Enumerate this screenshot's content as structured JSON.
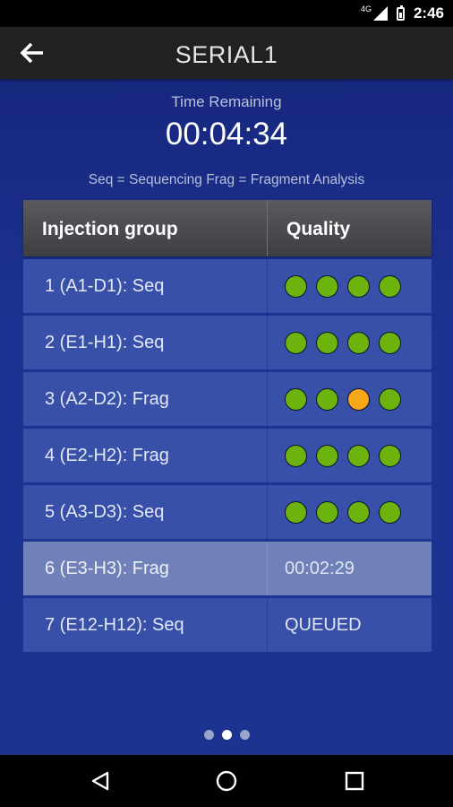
{
  "status_bar": {
    "network": "4G",
    "time": "2:46"
  },
  "app_bar": {
    "title": "SERIAL1",
    "back_icon": "arrow-left-icon"
  },
  "timer": {
    "label": "Time Remaining",
    "value": "00:04:34"
  },
  "legend": "Seq = Sequencing Frag = Fragment Analysis",
  "table": {
    "headers": {
      "group": "Injection group",
      "quality": "Quality"
    },
    "rows": [
      {
        "group": "1 (A1-D1): Seq",
        "quality_dots": [
          "green",
          "green",
          "green",
          "green"
        ]
      },
      {
        "group": "2 (E1-H1): Seq",
        "quality_dots": [
          "green",
          "green",
          "green",
          "green"
        ]
      },
      {
        "group": "3 (A2-D2): Frag",
        "quality_dots": [
          "green",
          "green",
          "orange",
          "green"
        ]
      },
      {
        "group": "4 (E2-H2): Frag",
        "quality_dots": [
          "green",
          "green",
          "green",
          "green"
        ]
      },
      {
        "group": "5 (A3-D3): Seq",
        "quality_dots": [
          "green",
          "green",
          "green",
          "green"
        ]
      },
      {
        "group": "6 (E3-H3): Frag",
        "status": "00:02:29",
        "active": true
      },
      {
        "group": "7 (E12-H12): Seq",
        "status": "QUEUED"
      }
    ]
  },
  "colors": {
    "green": "#6db30d",
    "orange": "#f7a71a"
  },
  "pager": {
    "count": 3,
    "current": 2
  },
  "nav": {
    "back": "triangle-back-icon",
    "home": "circle-home-icon",
    "recents": "square-recents-icon"
  }
}
